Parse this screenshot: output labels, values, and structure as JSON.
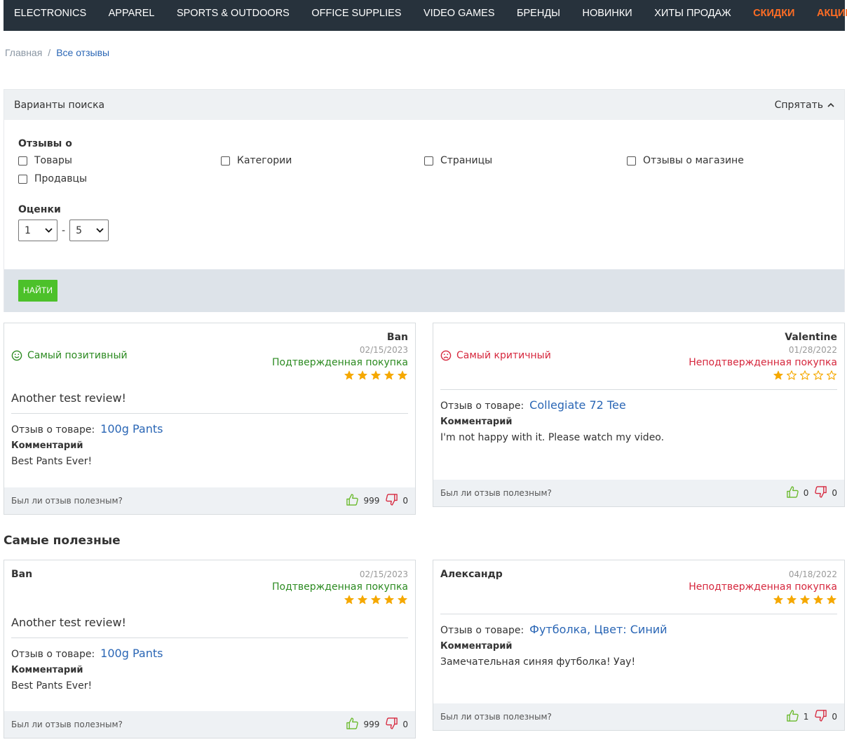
{
  "nav": {
    "items": [
      {
        "label": "ELECTRONICS",
        "hot": false
      },
      {
        "label": "APPAREL",
        "hot": false
      },
      {
        "label": "SPORTS & OUTDOORS",
        "hot": false
      },
      {
        "label": "OFFICE SUPPLIES",
        "hot": false
      },
      {
        "label": "VIDEO GAMES",
        "hot": false
      },
      {
        "label": "БРЕНДЫ",
        "hot": false
      },
      {
        "label": "НОВИНКИ",
        "hot": false
      },
      {
        "label": "ХИТЫ ПРОДАЖ",
        "hot": false
      },
      {
        "label": "СКИДКИ",
        "hot": true
      },
      {
        "label": "АКЦИИ",
        "hot": true
      }
    ],
    "accent_color": "#ff6d24"
  },
  "breadcrumb": {
    "home": "Главная",
    "separator": "/",
    "current": "Все отзывы"
  },
  "search": {
    "title": "Варианты поиска",
    "toggle_label": "Спрятать",
    "reviews_about_label": "Отзывы о",
    "checkboxes": [
      "Товары",
      "Категории",
      "Страницы",
      "Отзывы о магазине",
      "Продавцы"
    ],
    "ratings_label": "Оценки",
    "rating_from": "1",
    "rating_to": "5",
    "rating_dash": "-",
    "find_button": "НАЙТИ",
    "button_color": "#4cc12a"
  },
  "highlight": {
    "positive": {
      "badge": "Самый позитивный",
      "author": "Ban",
      "date": "02/15/2023",
      "verified": "Подтвержденная покупка",
      "rating": 5,
      "title": "Another test review!",
      "about_label": "Отзыв о товаре:",
      "product": "100g Pants",
      "comment_label": "Комментарий",
      "comment": "Best Pants Ever!",
      "helpful_label": "Был ли отзыв полезным?",
      "likes": "999",
      "dislikes": "0"
    },
    "critical": {
      "badge": "Самый критичный",
      "author": "Valentine",
      "date": "01/28/2022",
      "verified": "Неподтвержденная покупка",
      "rating": 1,
      "about_label": "Отзыв о товаре:",
      "product": "Collegiate 72 Tee",
      "comment_label": "Комментарий",
      "comment": "I'm not happy with it. Please watch my video.",
      "helpful_label": "Был ли отзыв полезным?",
      "likes": "0",
      "dislikes": "0"
    }
  },
  "most_helpful": {
    "title": "Самые полезные",
    "reviews": [
      {
        "author": "Ban",
        "date": "02/15/2023",
        "verified": "Подтвержденная покупка",
        "rating": 5,
        "title": "Another test review!",
        "about_label": "Отзыв о товаре:",
        "product": "100g Pants",
        "comment_label": "Комментарий",
        "comment": "Best Pants Ever!",
        "helpful_label": "Был ли отзыв полезным?",
        "likes": "999",
        "dislikes": "0"
      },
      {
        "author": "Александр",
        "date": "04/18/2022",
        "verified": "Неподтвержденная покупка",
        "rating": 5,
        "about_label": "Отзыв о товаре:",
        "product": "Футболка, Цвет: Синий",
        "comment_label": "Комментарий",
        "comment": "Замечательная синяя футболка! Уау!",
        "helpful_label": "Был ли отзыв полезным?",
        "likes": "1",
        "dislikes": "0"
      }
    ]
  },
  "icons": {
    "positive": "smile-icon",
    "critical": "frown-icon",
    "like": "thumbs-up-icon",
    "dislike": "thumbs-down-icon",
    "star": "star-icon",
    "toggle": "chevron-up-icon",
    "select": "chevron-down-icon"
  },
  "colors": {
    "positive": "#2b8a20",
    "negative": "#d6273d",
    "star": "#f5a800",
    "link": "#2a66b5"
  }
}
